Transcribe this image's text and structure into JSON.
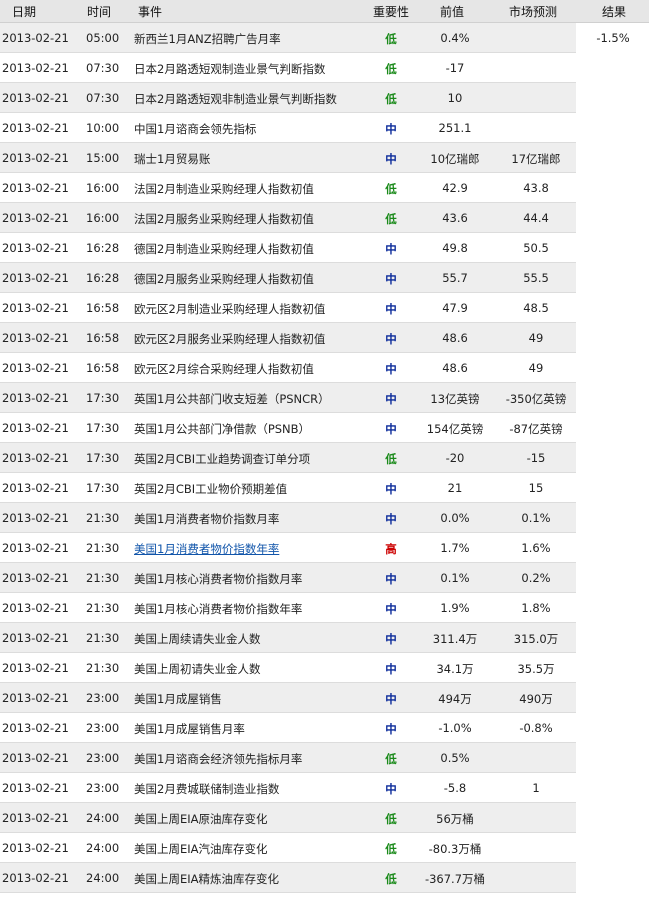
{
  "header": {
    "date": "日期",
    "time": "时间",
    "event": "事件",
    "importance": "重要性",
    "previous": "前值",
    "forecast": "市场预测",
    "actual": "结果"
  },
  "colors": {
    "low": "#1a8a1a",
    "mid": "#0a2a9a",
    "high": "#cc0000"
  },
  "rows": [
    {
      "date": "2013-02-21",
      "time": "05:00",
      "event": "新西兰1月ANZ招聘广告月率",
      "importance": "低",
      "level": "low",
      "previous": "0.4%",
      "forecast": "",
      "actual": "-1.5%"
    },
    {
      "date": "2013-02-21",
      "time": "07:30",
      "event": "日本2月路透短观制造业景气判断指数",
      "importance": "低",
      "level": "low",
      "previous": "-17",
      "forecast": "",
      "actual": ""
    },
    {
      "date": "2013-02-21",
      "time": "07:30",
      "event": "日本2月路透短观非制造业景气判断指数",
      "importance": "低",
      "level": "low",
      "previous": "10",
      "forecast": "",
      "actual": ""
    },
    {
      "date": "2013-02-21",
      "time": "10:00",
      "event": "中国1月谘商会领先指标",
      "importance": "中",
      "level": "mid",
      "previous": "251.1",
      "forecast": "",
      "actual": ""
    },
    {
      "date": "2013-02-21",
      "time": "15:00",
      "event": "瑞士1月贸易账",
      "importance": "中",
      "level": "mid",
      "previous": "10亿瑞郎",
      "forecast": "17亿瑞郎",
      "actual": ""
    },
    {
      "date": "2013-02-21",
      "time": "16:00",
      "event": "法国2月制造业采购经理人指数初值",
      "importance": "低",
      "level": "low",
      "previous": "42.9",
      "forecast": "43.8",
      "actual": ""
    },
    {
      "date": "2013-02-21",
      "time": "16:00",
      "event": "法国2月服务业采购经理人指数初值",
      "importance": "低",
      "level": "low",
      "previous": "43.6",
      "forecast": "44.4",
      "actual": ""
    },
    {
      "date": "2013-02-21",
      "time": "16:28",
      "event": "德国2月制造业采购经理人指数初值",
      "importance": "中",
      "level": "mid",
      "previous": "49.8",
      "forecast": "50.5",
      "actual": ""
    },
    {
      "date": "2013-02-21",
      "time": "16:28",
      "event": "德国2月服务业采购经理人指数初值",
      "importance": "中",
      "level": "mid",
      "previous": "55.7",
      "forecast": "55.5",
      "actual": ""
    },
    {
      "date": "2013-02-21",
      "time": "16:58",
      "event": "欧元区2月制造业采购经理人指数初值",
      "importance": "中",
      "level": "mid",
      "previous": "47.9",
      "forecast": "48.5",
      "actual": ""
    },
    {
      "date": "2013-02-21",
      "time": "16:58",
      "event": "欧元区2月服务业采购经理人指数初值",
      "importance": "中",
      "level": "mid",
      "previous": "48.6",
      "forecast": "49",
      "actual": ""
    },
    {
      "date": "2013-02-21",
      "time": "16:58",
      "event": "欧元区2月综合采购经理人指数初值",
      "importance": "中",
      "level": "mid",
      "previous": "48.6",
      "forecast": "49",
      "actual": ""
    },
    {
      "date": "2013-02-21",
      "time": "17:30",
      "event": "英国1月公共部门收支短差（PSNCR）",
      "importance": "中",
      "level": "mid",
      "previous": "13亿英镑",
      "forecast": "-350亿英镑",
      "actual": ""
    },
    {
      "date": "2013-02-21",
      "time": "17:30",
      "event": "英国1月公共部门净借款（PSNB）",
      "importance": "中",
      "level": "mid",
      "previous": "154亿英镑",
      "forecast": "-87亿英镑",
      "actual": ""
    },
    {
      "date": "2013-02-21",
      "time": "17:30",
      "event": "英国2月CBI工业趋势调查订单分项",
      "importance": "低",
      "level": "low",
      "previous": "-20",
      "forecast": "-15",
      "actual": ""
    },
    {
      "date": "2013-02-21",
      "time": "17:30",
      "event": "英国2月CBI工业物价预期差值",
      "importance": "中",
      "level": "mid",
      "previous": "21",
      "forecast": "15",
      "actual": ""
    },
    {
      "date": "2013-02-21",
      "time": "21:30",
      "event": "美国1月消费者物价指数月率",
      "importance": "中",
      "level": "mid",
      "previous": "0.0%",
      "forecast": "0.1%",
      "actual": ""
    },
    {
      "date": "2013-02-21",
      "time": "21:30",
      "event": "美国1月消费者物价指数年率",
      "importance": "高",
      "level": "high",
      "previous": "1.7%",
      "forecast": "1.6%",
      "actual": "",
      "link": true
    },
    {
      "date": "2013-02-21",
      "time": "21:30",
      "event": "美国1月核心消费者物价指数月率",
      "importance": "中",
      "level": "mid",
      "previous": "0.1%",
      "forecast": "0.2%",
      "actual": ""
    },
    {
      "date": "2013-02-21",
      "time": "21:30",
      "event": "美国1月核心消费者物价指数年率",
      "importance": "中",
      "level": "mid",
      "previous": "1.9%",
      "forecast": "1.8%",
      "actual": ""
    },
    {
      "date": "2013-02-21",
      "time": "21:30",
      "event": "美国上周续请失业金人数",
      "importance": "中",
      "level": "mid",
      "previous": "311.4万",
      "forecast": "315.0万",
      "actual": ""
    },
    {
      "date": "2013-02-21",
      "time": "21:30",
      "event": "美国上周初请失业金人数",
      "importance": "中",
      "level": "mid",
      "previous": "34.1万",
      "forecast": "35.5万",
      "actual": ""
    },
    {
      "date": "2013-02-21",
      "time": "23:00",
      "event": "美国1月成屋销售",
      "importance": "中",
      "level": "mid",
      "previous": "494万",
      "forecast": "490万",
      "actual": ""
    },
    {
      "date": "2013-02-21",
      "time": "23:00",
      "event": "美国1月成屋销售月率",
      "importance": "中",
      "level": "mid",
      "previous": "-1.0%",
      "forecast": "-0.8%",
      "actual": ""
    },
    {
      "date": "2013-02-21",
      "time": "23:00",
      "event": "美国1月谘商会经济领先指标月率",
      "importance": "低",
      "level": "low",
      "previous": "0.5%",
      "forecast": "",
      "actual": ""
    },
    {
      "date": "2013-02-21",
      "time": "23:00",
      "event": "美国2月费城联储制造业指数",
      "importance": "中",
      "level": "mid",
      "previous": "-5.8",
      "forecast": "1",
      "actual": ""
    },
    {
      "date": "2013-02-21",
      "time": "24:00",
      "event": "美国上周EIA原油库存变化",
      "importance": "低",
      "level": "low",
      "previous": "56万桶",
      "forecast": "",
      "actual": ""
    },
    {
      "date": "2013-02-21",
      "time": "24:00",
      "event": "美国上周EIA汽油库存变化",
      "importance": "低",
      "level": "low",
      "previous": "-80.3万桶",
      "forecast": "",
      "actual": ""
    },
    {
      "date": "2013-02-21",
      "time": "24:00",
      "event": "美国上周EIA精炼油库存变化",
      "importance": "低",
      "level": "low",
      "previous": "-367.7万桶",
      "forecast": "",
      "actual": ""
    }
  ]
}
